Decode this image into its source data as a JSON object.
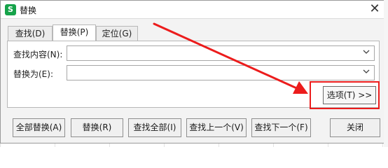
{
  "window": {
    "title": "替换",
    "app_icon_glyph": "S",
    "close_glyph": "✕"
  },
  "tabs": [
    {
      "label": "查找(D)",
      "active": false
    },
    {
      "label": "替换(P)",
      "active": true
    },
    {
      "label": "定位(G)",
      "active": false
    }
  ],
  "find": {
    "label": "查找内容(N):",
    "value": ""
  },
  "replace": {
    "label": "替换为(E):",
    "value": ""
  },
  "options_button": "选项(T) >>",
  "buttons": {
    "replace_all": "全部替换(A)",
    "replace": "替换(R)",
    "find_all": "查找全部(I)",
    "find_prev": "查找上一个(V)",
    "find_next": "查找下一个(F)",
    "close": "关闭"
  },
  "annotation": {
    "color": "#ec1c1c"
  },
  "icons": {
    "dropdown": "chevron-down-icon",
    "app": "wps-spreadsheet-icon"
  }
}
